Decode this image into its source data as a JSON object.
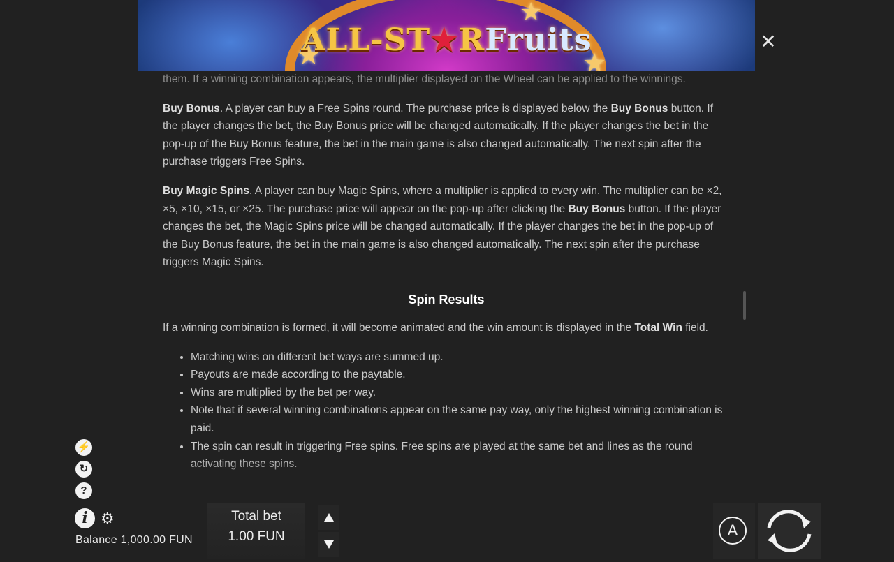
{
  "banner": {
    "logo_part1": "ALL-ST",
    "logo_star": "★",
    "logo_part2": "R",
    "logo_part3": "Fruits"
  },
  "close_label": "✕",
  "content": {
    "faded_line": "them. If a winning combination appears, the multiplier displayed on the Wheel can be applied to the winnings.",
    "buy_bonus": {
      "title": "Buy Bonus",
      "text1": ". A player can buy a Free Spins round. The purchase price is displayed below the ",
      "bold2": "Buy Bonus",
      "text2": " button. If the player changes the bet, the Buy Bonus price will be changed automatically. If the player changes the bet in the pop-up of the Buy Bonus feature, the bet in the main game is also changed automatically. The next spin after the purchase triggers Free Spins."
    },
    "buy_magic": {
      "title": "Buy Magic Spins",
      "text1": ". A player can buy Magic Spins, where a multiplier is applied to every win. The multiplier can be ×2, ×5, ×10, ×15, or ×25. The purchase price will appear on the pop-up after clicking the ",
      "bold2": "Buy Bonus",
      "text2": " button. If the player changes the bet, the Magic Spins price will be changed automatically. If the player changes the bet in the pop-up of the Buy Bonus feature, the bet in the main game is also changed automatically. The next spin after the purchase triggers Magic Spins."
    },
    "spin_results": {
      "heading": "Spin Results",
      "intro1": "If a winning combination is formed, it will become animated and the win amount is displayed in the ",
      "intro_bold": "Total Win",
      "intro2": " field.",
      "bullets": [
        "Matching wins on different bet ways are summed up.",
        "Payouts are made according to the paytable.",
        "Wins are multiplied by the bet per way.",
        "Note that if several winning combinations appear on the same pay way, only the highest winning combination is paid.",
        "The spin can result in triggering Free spins. Free spins are played at the same bet and lines as the round activating these spins."
      ]
    }
  },
  "side_icons": {
    "turbo": "⚡",
    "autoplay_history": "↻",
    "help": "?",
    "info": "i",
    "settings": "⚙"
  },
  "balance": "Balance 1,000.00 FUN",
  "bet": {
    "label": "Total bet",
    "value": "1.00 FUN"
  },
  "auto_label": "A",
  "colors": {
    "background": "#212121",
    "text": "#c9c9c9",
    "heading": "#ffffff",
    "logo_gold": "#f6c544"
  }
}
